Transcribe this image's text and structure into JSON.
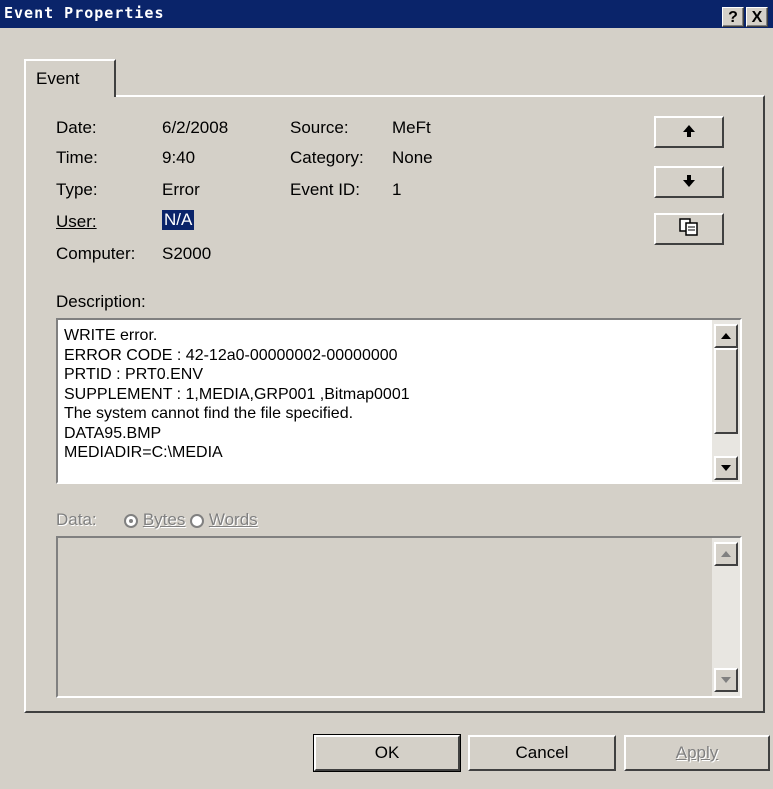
{
  "window": {
    "title": "Event Properties",
    "help_button": "?",
    "close_button": "X"
  },
  "tabs": [
    {
      "label": "Event",
      "active": true
    }
  ],
  "fields": {
    "date_label": "Date:",
    "date_value": "6/2/2008",
    "time_label": "Time:",
    "time_value": "9:40",
    "type_label": "Type:",
    "type_value": "Error",
    "user_label": "User:",
    "user_value": "N/A",
    "computer_label": "Computer:",
    "computer_value": "S2000",
    "source_label": "Source:",
    "source_value": "MeFt",
    "category_label": "Category:",
    "category_value": "None",
    "event_id_label": "Event ID:",
    "event_id_value": "1"
  },
  "side_buttons": {
    "up_icon": "arrow-up-icon",
    "down_icon": "arrow-down-icon",
    "copy_icon": "copy-icon"
  },
  "description": {
    "label": "Description:",
    "lines": [
      "WRITE error.",
      "ERROR CODE : 42-12a0-00000002-00000000",
      "PRTID : PRT0.ENV",
      "SUPPLEMENT : 1,MEDIA,GRP001  ,Bitmap0001",
      "The system cannot find the file specified.",
      "DATA95.BMP",
      "MEDIADIR=C:\\MEDIA"
    ]
  },
  "data_section": {
    "label": "Data:",
    "option_bytes": "Bytes",
    "option_words": "Words",
    "selected": "Bytes"
  },
  "footer": {
    "ok": "OK",
    "cancel": "Cancel",
    "apply": "Apply"
  },
  "colors": {
    "titlebar": "#0a246a",
    "face": "#d4d0c8",
    "selection": "#0a246a"
  }
}
